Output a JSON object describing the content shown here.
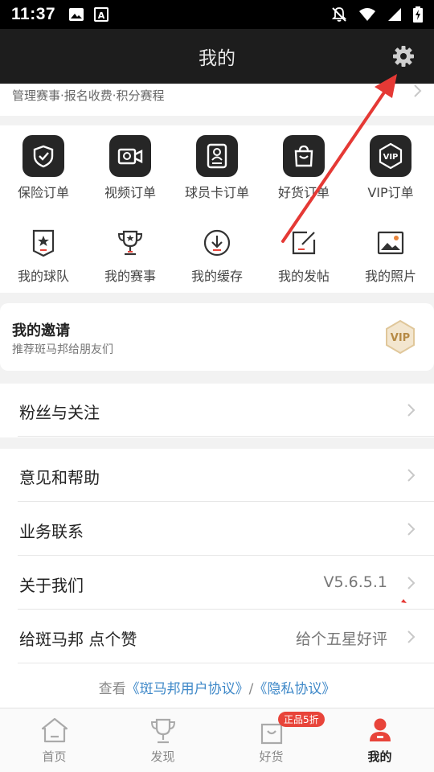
{
  "status_bar": {
    "time": "11:37",
    "icons": [
      "image-icon",
      "font-icon",
      "bell-off-icon",
      "wifi-icon",
      "signal-icon",
      "battery-charging-icon"
    ]
  },
  "header": {
    "title": "我的",
    "settings_icon": "gear-icon"
  },
  "peek": {
    "text": "管理赛事·报名收费·积分赛程"
  },
  "grid": {
    "row1": [
      {
        "label": "保险订单",
        "icon": "shield-check-icon"
      },
      {
        "label": "视频订单",
        "icon": "video-camera-icon"
      },
      {
        "label": "球员卡订单",
        "icon": "player-card-icon"
      },
      {
        "label": "好货订单",
        "icon": "shopping-bag-icon"
      },
      {
        "label": "VIP订单",
        "icon": "vip-hexagon-icon"
      }
    ],
    "row2": [
      {
        "label": "我的球队",
        "icon": "team-badge-icon"
      },
      {
        "label": "我的赛事",
        "icon": "trophy-icon"
      },
      {
        "label": "我的缓存",
        "icon": "download-icon"
      },
      {
        "label": "我的发帖",
        "icon": "edit-post-icon"
      },
      {
        "label": "我的照片",
        "icon": "photo-icon"
      }
    ]
  },
  "invite": {
    "title": "我的邀请",
    "subtitle": "推荐斑马邦给朋友们",
    "badge": "VIP"
  },
  "menu": {
    "fans": "粉丝与关注",
    "feedback": "意见和帮助",
    "business": "业务联系",
    "about": "关于我们",
    "version": "V5.6.5.1",
    "rate": "给斑马邦 点个赞",
    "rate_value": "给个五星好评"
  },
  "agreement": {
    "prefix": "查看",
    "user_agreement": "《斑马邦用户协议》",
    "separator": "/",
    "privacy": "《隐私协议》"
  },
  "tabbar": {
    "home": "首页",
    "discover": "发现",
    "goods": "好货",
    "goods_badge": "正品5折",
    "mine": "我的"
  },
  "colors": {
    "accent": "#e8443a",
    "link": "#3e88c8",
    "header_bg": "#1d1d1d",
    "annotation_arrow": "#e53935"
  }
}
